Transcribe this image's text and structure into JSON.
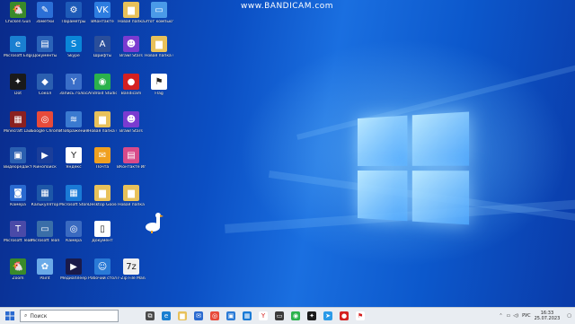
{
  "watermark": "www.BANDICAM.com",
  "desktop_icons": [
    {
      "label": "Chicken Gun",
      "color": "#3a8a2a",
      "glyph": "🐔"
    },
    {
      "label": "Заметки",
      "color": "#2b6fd6",
      "glyph": "✎"
    },
    {
      "label": "Параметры",
      "color": "#1e5bb8",
      "glyph": "⚙"
    },
    {
      "label": "ВКонтакте",
      "color": "#2d7de0",
      "glyph": "VK"
    },
    {
      "label": "Новая папка",
      "color": "#e8c15a",
      "glyph": "▆"
    },
    {
      "label": "Этот компьютер",
      "color": "#4a9ae8",
      "glyph": "▭"
    },
    {
      "label": "Microsoft Edge",
      "color": "#1a7fd1",
      "glyph": "e"
    },
    {
      "label": "Документы",
      "color": "#2a63b8",
      "glyph": "▤"
    },
    {
      "label": "Skype",
      "color": "#0a86d8",
      "glyph": "S"
    },
    {
      "label": "Шрифты",
      "color": "#2a4e9a",
      "glyph": "A"
    },
    {
      "label": "Brawl Stars",
      "color": "#7a3bd0",
      "glyph": "☻"
    },
    {
      "label": "Новая папка (2)",
      "color": "#e8c15a",
      "glyph": "▆"
    },
    {
      "label": "Dot",
      "color": "#1a1a1a",
      "glyph": "✦"
    },
    {
      "label": "Сокол",
      "color": "#2b5fb0",
      "glyph": "◆"
    },
    {
      "label": "Запись голоса",
      "color": "#3a6ec8",
      "glyph": "Y"
    },
    {
      "label": "Android Studio",
      "color": "#2bb24c",
      "glyph": "◉"
    },
    {
      "label": "Bandicam",
      "color": "#d42020",
      "glyph": "●"
    },
    {
      "label": "Flag",
      "color": "#ffffff",
      "glyph": "⚑"
    },
    {
      "label": "Minecraft Launcher",
      "color": "#8a2020",
      "glyph": "▦"
    },
    {
      "label": "Google Chrome",
      "color": "#e84a3a",
      "glyph": "◎"
    },
    {
      "label": "Изображения",
      "color": "#3a7ad0",
      "glyph": "≋"
    },
    {
      "label": "Новая папка (3)",
      "color": "#e8c15a",
      "glyph": "▆"
    },
    {
      "label": "Brawl Stars",
      "color": "#7a3bd0",
      "glyph": "☻"
    },
    {
      "label": "Видеоредактор",
      "color": "#2a5fb0",
      "glyph": "▣"
    },
    {
      "label": "Кинопоиск",
      "color": "#1a3e9a",
      "glyph": "▶"
    },
    {
      "label": "Яндекс",
      "color": "#ffffff",
      "glyph": "Y"
    },
    {
      "label": "Почта",
      "color": "#f0a020",
      "glyph": "✉"
    },
    {
      "label": "ВКонтакте Игры",
      "color": "#d84a8a",
      "glyph": "▤"
    },
    {
      "label": "Камера",
      "color": "#2a6ad0",
      "glyph": "◙"
    },
    {
      "label": "Калькулятор",
      "color": "#1d57a8",
      "glyph": "▦"
    },
    {
      "label": "Microsoft Store",
      "color": "#1a7ad6",
      "glyph": "▦"
    },
    {
      "label": "Desktop Goose",
      "color": "#e8c15a",
      "glyph": "▆"
    },
    {
      "label": "Новая папка",
      "color": "#e8c15a",
      "glyph": "▆"
    },
    {
      "label": "Microsoft Teams",
      "color": "#4a4aa8",
      "glyph": "T"
    },
    {
      "label": "Microsoft Teams",
      "color": "#3a6ea8",
      "glyph": "▭"
    },
    {
      "label": "Камера",
      "color": "#3a6ac0",
      "glyph": "◎"
    },
    {
      "label": "Документ",
      "color": "#ffffff",
      "glyph": "▯"
    },
    {
      "label": "Zoom",
      "color": "#3a8a2a",
      "glyph": "🐔"
    },
    {
      "label": "Paint",
      "color": "#6aaae8",
      "glyph": "✿"
    },
    {
      "label": "Медиаплеер",
      "color": "#1a1a4a",
      "glyph": "▶"
    },
    {
      "label": "Рабочий стол",
      "color": "#2a7ad6",
      "glyph": "☺"
    },
    {
      "label": "7-Zip File Manager",
      "color": "#f0f0f0",
      "glyph": "7z"
    }
  ],
  "taskbar": {
    "search_placeholder": "Поиск",
    "apps": [
      {
        "name": "task-view",
        "color": "#4a4a4a",
        "glyph": "⧉"
      },
      {
        "name": "edge",
        "color": "#1a7fd1",
        "glyph": "e"
      },
      {
        "name": "explorer",
        "color": "#e8c15a",
        "glyph": "▆"
      },
      {
        "name": "mail",
        "color": "#2a6ad0",
        "glyph": "✉"
      },
      {
        "name": "chrome",
        "color": "#e84a3a",
        "glyph": "◎"
      },
      {
        "name": "photos",
        "color": "#2a7ad6",
        "glyph": "▣"
      },
      {
        "name": "store",
        "color": "#1a7ad6",
        "glyph": "▦"
      },
      {
        "name": "yandex",
        "color": "#ffffff",
        "glyph": "Y"
      },
      {
        "name": "terminal",
        "color": "#3a3a3a",
        "glyph": "▭"
      },
      {
        "name": "android",
        "color": "#2bb24c",
        "glyph": "◉"
      },
      {
        "name": "dot",
        "color": "#1a1a1a",
        "glyph": "✦"
      },
      {
        "name": "telegram",
        "color": "#2a9ae8",
        "glyph": "➤"
      },
      {
        "name": "bandicam",
        "color": "#d42020",
        "glyph": "●"
      },
      {
        "name": "flag",
        "color": "#ffffff",
        "glyph": "⚑"
      }
    ],
    "lang": "РУС",
    "time": "16:33",
    "date": "25.07.2023"
  }
}
